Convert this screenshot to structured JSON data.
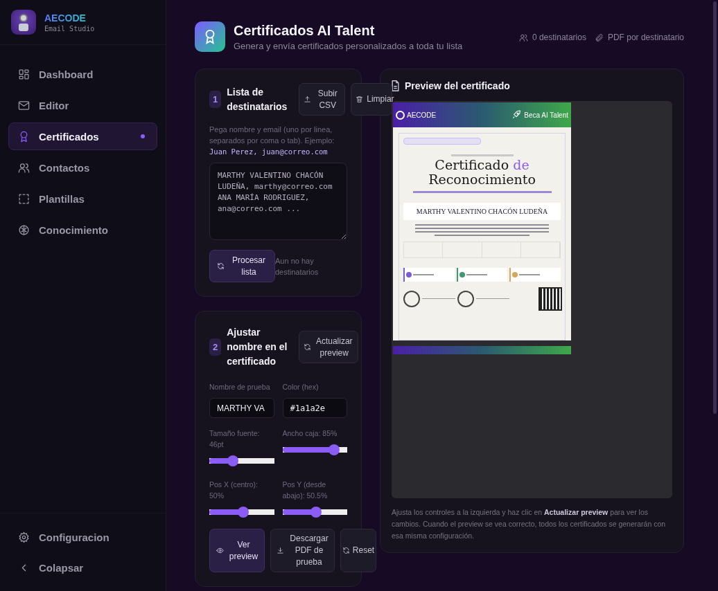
{
  "sidebar": {
    "brand": "AECODE",
    "brand_sub": "Email Studio",
    "items": [
      {
        "label": "Dashboard",
        "selected": false
      },
      {
        "label": "Editor",
        "selected": false
      },
      {
        "label": "Certificados",
        "selected": true
      },
      {
        "label": "Contactos",
        "selected": false
      },
      {
        "label": "Plantillas",
        "selected": false
      },
      {
        "label": "Conocimiento",
        "selected": false
      }
    ],
    "footer": [
      "Configuracion",
      "Colapsar"
    ]
  },
  "header": {
    "title": "Certificados AI Talent",
    "subtitle": "Genera y envía certificados personalizados a toda tu lista",
    "stats": [
      "0 destinatarios",
      "PDF por destinatario"
    ]
  },
  "recipients": {
    "step": "1",
    "title": "Lista de destinatarios",
    "buttons": [
      "Subir CSV",
      "Limpiar"
    ],
    "help": "Pega nombre y email (uno por linea, separados por coma o tab). Ejemplo:",
    "example": "Juan Perez, juan@correo.com",
    "placeholder": "MARTHY VALENTINO CHACÓN LUDEÑA, marthy@correo.com ANA MARÍA RODRIGUEZ, ana@correo.com ...",
    "process_button": "Procesar lista",
    "status": "Aun no hay destinatarios"
  },
  "adjust": {
    "step": "2",
    "title": "Ajustar nombre en el certificado",
    "refresh_button": "Actualizar preview",
    "fields": [
      {
        "label": "Nombre de prueba",
        "value": "MARTHY VA"
      },
      {
        "label": "Color (hex)",
        "value": "#1a1a2e"
      }
    ],
    "sliders": [
      {
        "label": "Tamaño fuente: 46pt",
        "level": 0.36
      },
      {
        "label": "Ancho caja: 85%",
        "level": 0.8
      },
      {
        "label": "Pos X (centro): 50%",
        "level": 0.52
      },
      {
        "label": "Pos Y (desde abajo): 50.5%",
        "level": 0.52
      }
    ],
    "buttons": [
      {
        "label": "Ver preview",
        "selected": true
      },
      {
        "label": "Descargar PDF de prueba",
        "selected": false
      },
      {
        "label": "Reset",
        "selected": false
      }
    ]
  },
  "preview": {
    "title": "Preview del certificado",
    "certificate": {
      "logo": "AECODE",
      "program": "Beca AI Talent",
      "title_start": "Certificado",
      "title_accent": "de",
      "title_end": "Reconocimiento",
      "name": "MARTHY VALENTINO CHACÓN LUDEÑA",
      "highlights": [
        {
          "color": "#7c5cd6"
        },
        {
          "color": "#3f9a6e"
        },
        {
          "color": "#d6a85c"
        }
      ]
    },
    "note": "Ajusta los controles a la izquierda y haz clic en **Actualizar preview** para ver los cambios. Cuando el preview se vea correcto, todos los certificados se generarán con esa misma configuración."
  }
}
